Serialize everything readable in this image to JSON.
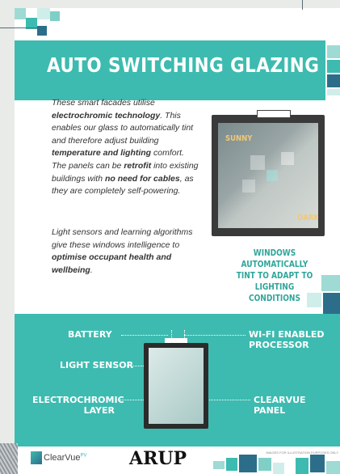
{
  "title": "AUTO SWITCHING GLAZING",
  "paragraphs": {
    "p1": {
      "a": "These smart facades utilise",
      "b": "electrochromic technology",
      "c": ". This enables our glass to automatically tint and therefore adjust building ",
      "d": "temperature and lighting",
      "e": " comfort."
    },
    "p2": {
      "a": "The panels can be ",
      "b": "retrofit",
      "c": " into existing buildings with ",
      "d": "no need for cables",
      "e": ", as they are completely self-powering."
    },
    "p3": {
      "a": "Light sensors and learning algorithms give these windows intelligence to ",
      "b": "optimise occupant health and wellbeing",
      "c": "."
    }
  },
  "window": {
    "sunny": "SUNNY",
    "dark": "DARK"
  },
  "caption": {
    "line1": "WINDOWS AUTOMATICALLY",
    "line2": "TINT TO ADAPT TO LIGHTING",
    "line3": "CONDITIONS"
  },
  "diagram": {
    "battery": "BATTERY",
    "wifi1": "WI-FI ENABLED",
    "wifi2": "PROCESSOR",
    "light_sensor": "LIGHT SENSOR",
    "electro1": "ELECTROCHROMIC",
    "electro2": "LAYER",
    "clearvue": "CLEARVUE PANEL"
  },
  "footer": {
    "note": "IMAGES FOR ILLUSTRATION PURPOSES ONLY",
    "clearvue_logo": "ClearVue",
    "clearvue_sup": "PV",
    "arup_logo": "ARUP"
  },
  "colors": {
    "accent": "#3dbbb0",
    "caption": "#2fa59a",
    "window_label": "#f0c878"
  }
}
